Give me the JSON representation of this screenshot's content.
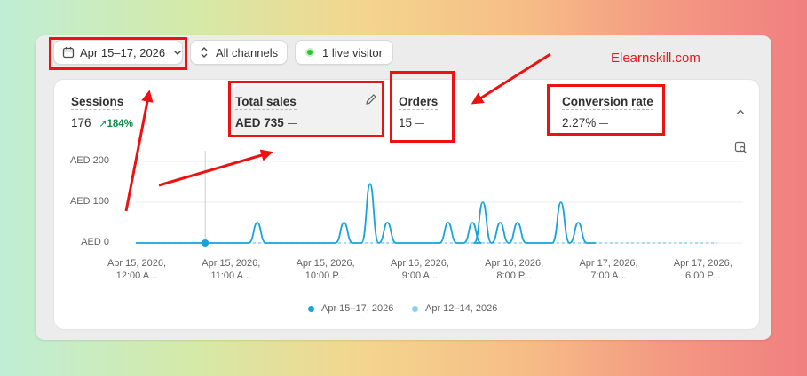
{
  "filters": {
    "date_range": "Apr 15–17, 2026",
    "channels": "All channels",
    "live_visitor": "1 live visitor"
  },
  "watermark": "Elearnskill.com",
  "metrics": {
    "sessions": {
      "label": "Sessions",
      "value": "176",
      "change": "184%"
    },
    "total_sales": {
      "label": "Total sales",
      "value": "AED 735"
    },
    "orders": {
      "label": "Orders",
      "value": "15"
    },
    "conversion_rate": {
      "label": "Conversion rate",
      "value": "2.27%"
    }
  },
  "colors": {
    "current_series": "#1aa3d9",
    "previous_series": "#8dd0ec",
    "live_dot": "#29c62f",
    "positive": "#0c8a4a",
    "annotation": "#e8191f"
  },
  "chart_data": {
    "type": "line",
    "ylabel": "",
    "xlabel": "",
    "y_ticks": [
      "AED 200",
      "AED 100",
      "AED 0"
    ],
    "ylim": [
      0,
      200
    ],
    "x_tick_labels": [
      [
        "Apr 15, 2026,",
        "12:00 A..."
      ],
      [
        "Apr 15, 2026,",
        "11:00 A..."
      ],
      [
        "Apr 15, 2026,",
        "10:00 P..."
      ],
      [
        "Apr 16, 2026,",
        "9:00 A..."
      ],
      [
        "Apr 16, 2026,",
        "8:00 P..."
      ],
      [
        "Apr 17, 2026,",
        "7:00 A..."
      ],
      [
        "Apr 17, 2026,",
        "6:00 P..."
      ]
    ],
    "grid": true,
    "legend_position": "bottom",
    "series": [
      {
        "name": "Apr 15–17, 2026",
        "peaks": [
          [
            7,
            50
          ],
          [
            12,
            50
          ],
          [
            13.5,
            145
          ],
          [
            14.5,
            50
          ],
          [
            18,
            50
          ],
          [
            19.4,
            50
          ],
          [
            20,
            100
          ],
          [
            21,
            50
          ],
          [
            22,
            50
          ],
          [
            24.5,
            100
          ],
          [
            25.5,
            50
          ]
        ],
        "x_end": 26.5
      },
      {
        "name": "Apr 12–14, 2026",
        "peaks": [],
        "x_end": 33.5
      }
    ],
    "highlight_point": {
      "x": 4,
      "y": 0
    }
  }
}
